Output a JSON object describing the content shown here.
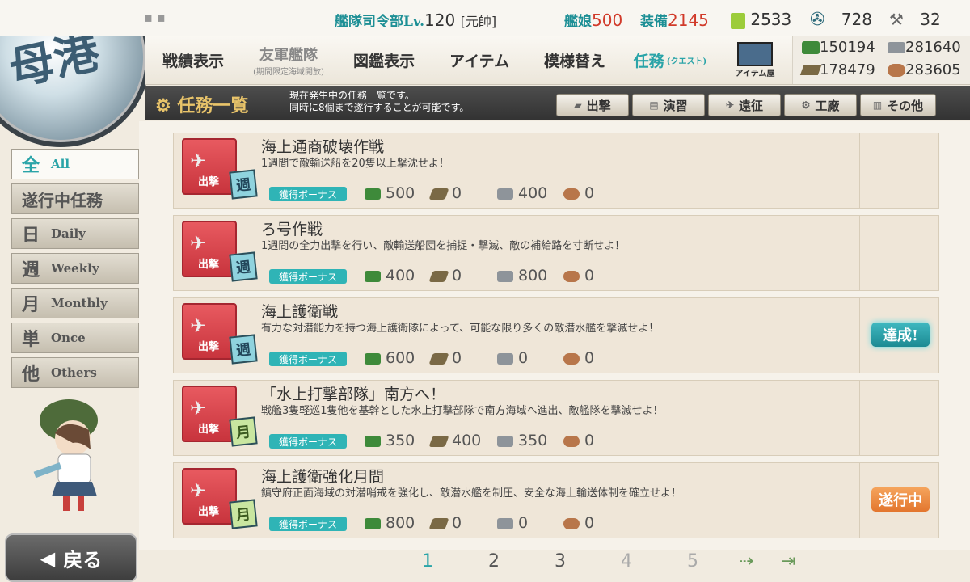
{
  "top": {
    "hq_label": "艦隊司令部Lv.",
    "hq_level": "120",
    "rank": "[元帥]",
    "ship_label": "艦娘",
    "ship_count": "500",
    "equip_label": "装備",
    "equip_count": "2145",
    "bucket": "2533",
    "dev_mat": "728",
    "screw": "32"
  },
  "nav": {
    "items": [
      {
        "label": "戦績表示"
      },
      {
        "label": "友軍艦隊",
        "sub": "(期間限定海域開放)"
      },
      {
        "label": "図鑑表示"
      },
      {
        "label": "アイテム"
      },
      {
        "label": "模様替え"
      },
      {
        "label": "任務",
        "sub": "(クエスト)"
      }
    ],
    "shop_label": "アイテム屋"
  },
  "resources": {
    "fuel": "150194",
    "steel": "281640",
    "ammo": "178479",
    "bauxite": "283605"
  },
  "header": {
    "title": "任務一覧",
    "desc1": "現在発生中の任務一覧です。",
    "desc2": "同時に8個まで遂行することが可能です。"
  },
  "categories": [
    {
      "label": "出撃"
    },
    {
      "label": "演習"
    },
    {
      "label": "遠征"
    },
    {
      "label": "工廠"
    },
    {
      "label": "その他"
    }
  ],
  "sidebar": [
    {
      "kanji": "全",
      "label": "All"
    },
    {
      "kanji": "",
      "label": "遂行中任務"
    },
    {
      "kanji": "日",
      "label": "Daily"
    },
    {
      "kanji": "週",
      "label": "Weekly"
    },
    {
      "kanji": "月",
      "label": "Monthly"
    },
    {
      "kanji": "単",
      "label": "Once"
    },
    {
      "kanji": "他",
      "label": "Others"
    }
  ],
  "quests": [
    {
      "name": "海上通商破壊作戦",
      "desc": "1週間で敵輸送船を20隻以上撃沈せよ！",
      "freq": "週",
      "fuel": "500",
      "ammo": "0",
      "steel": "400",
      "baux": "0",
      "status": ""
    },
    {
      "name": "ろ号作戦",
      "desc": "1週間の全力出撃を行い、敵輸送船団を捕捉・撃滅、敵の補給路を寸断せよ！",
      "freq": "週",
      "fuel": "400",
      "ammo": "0",
      "steel": "800",
      "baux": "0",
      "status": ""
    },
    {
      "name": "海上護衛戦",
      "desc": "有力な対潜能力を持つ海上護衛隊によって、可能な限り多くの敵潜水艦を撃滅せよ！",
      "freq": "週",
      "fuel": "600",
      "ammo": "0",
      "steel": "0",
      "baux": "0",
      "status": "達成!"
    },
    {
      "name": "「水上打撃部隊」南方へ！",
      "desc": "戦艦3隻軽巡1隻他を基幹とした水上打撃部隊で南方海域へ進出、敵艦隊を撃滅せよ！",
      "freq": "月",
      "fuel": "350",
      "ammo": "400",
      "steel": "350",
      "baux": "0",
      "status": ""
    },
    {
      "name": "海上護衛強化月間",
      "desc": "鎮守府正面海域の対潜哨戒を強化し、敵潜水艦を制圧、安全な海上輸送体制を確立せよ！",
      "freq": "月",
      "fuel": "800",
      "ammo": "0",
      "steel": "0",
      "baux": "0",
      "status": "遂行中"
    }
  ],
  "quest_ui": {
    "sortie_label": "出撃",
    "bonus_label": "獲得ボーナス"
  },
  "pager": [
    "1",
    "2",
    "3",
    "4",
    "5"
  ],
  "back_label": "戻る"
}
